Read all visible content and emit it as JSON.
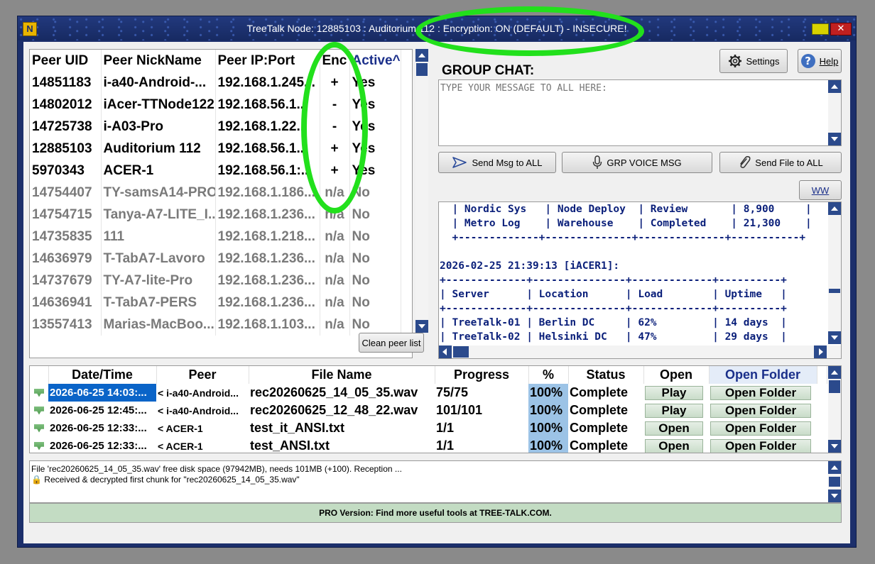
{
  "window": {
    "title": "TreeTalk Node: 12885103 : Auditorium 112 : Encryption: ON (DEFAULT) - INSECURE!",
    "app_icon": "N",
    "close_glyph": "✕"
  },
  "peers": {
    "headers": [
      "Peer UID",
      "Peer NickName",
      "Peer IP:Port",
      "Enc",
      "Active^"
    ],
    "rows": [
      {
        "uid": "14851183",
        "nick": "i-a40-Android-...",
        "ip": "192.168.1.245...",
        "enc": "+",
        "active": "Yes",
        "online": true
      },
      {
        "uid": "14802012",
        "nick": "iAcer-TTNode122",
        "ip": "192.168.56.1...",
        "enc": "-",
        "active": "Yes",
        "online": true
      },
      {
        "uid": "14725738",
        "nick": "i-A03-Pro",
        "ip": "192.168.1.22...",
        "enc": "-",
        "active": "Yes",
        "online": true
      },
      {
        "uid": "12885103",
        "nick": "Auditorium 112",
        "ip": "192.168.56.1...",
        "enc": "+",
        "active": "Yes",
        "online": true
      },
      {
        "uid": "5970343",
        "nick": "ACER-1",
        "ip": "192.168.56.1:...",
        "enc": "+",
        "active": "Yes",
        "online": true
      },
      {
        "uid": "14754407",
        "nick": "TY-samsA14-PRO",
        "ip": "192.168.1.186...",
        "enc": "n/a",
        "active": "No",
        "online": false
      },
      {
        "uid": "14754715",
        "nick": "Tanya-A7-LITE_I...",
        "ip": "192.168.1.236...",
        "enc": "n/a",
        "active": "No",
        "online": false
      },
      {
        "uid": "14735835",
        "nick": "111",
        "ip": "192.168.1.218...",
        "enc": "n/a",
        "active": "No",
        "online": false
      },
      {
        "uid": "14636979",
        "nick": "T-TabA7-Lavoro",
        "ip": "192.168.1.236...",
        "enc": "n/a",
        "active": "No",
        "online": false
      },
      {
        "uid": "14737679",
        "nick": "TY-A7-lite-Pro",
        "ip": "192.168.1.236...",
        "enc": "n/a",
        "active": "No",
        "online": false
      },
      {
        "uid": "14636941",
        "nick": "T-TabA7-PERS",
        "ip": "192.168.1.236...",
        "enc": "n/a",
        "active": "No",
        "online": false
      },
      {
        "uid": "13557413",
        "nick": "Marias-MacBoo...",
        "ip": "192.168.1.103...",
        "enc": "n/a",
        "active": "No",
        "online": false
      }
    ],
    "clean_label": "Clean peer list"
  },
  "chat": {
    "title": "GROUP CHAT:",
    "placeholder": "TYPE YOUR MESSAGE TO ALL HERE:",
    "settings_label": "Settings",
    "help_label": "Help",
    "send_msg_label": "Send Msg to ALL",
    "voice_label": "GRP VOICE MSG",
    "send_file_label": "Send File to ALL",
    "ww_label": "WW",
    "log_lines": [
      "  | Nordic Sys   | Node Deploy  | Review       | 8,900     |",
      "  | Metro Log    | Warehouse    | Completed    | 21,300    |",
      "  +-------------+--------------+--------------+-----------+",
      "",
      "2026-02-25 21:39:13 [iACER1]:",
      "+-------------+---------------+-------------+----------+",
      "| Server      | Location      | Load        | Uptime   |",
      "+-------------+---------------+-------------+----------+",
      "| TreeTalk-01 | Berlin DC     | 62%         | 14 days  |",
      "| TreeTalk-02 | Helsinki DC   | 47%         | 29 days  |"
    ]
  },
  "transfers": {
    "headers": [
      "Date/Time",
      "Peer",
      "File Name",
      "Progress",
      "%",
      "Status",
      "Open",
      "Open Folder"
    ],
    "rows": [
      {
        "date": "2026-06-25 14:03:...",
        "peer": "< i-a40-Android...",
        "file": "rec20260625_14_05_35.wav",
        "progress": "75/75",
        "pct": "100%",
        "status": "Complete",
        "open": "Play",
        "folder": "Open Folder"
      },
      {
        "date": "2026-06-25 12:45:...",
        "peer": "< i-a40-Android...",
        "file": "rec20260625_12_48_22.wav",
        "progress": "101/101",
        "pct": "100%",
        "status": "Complete",
        "open": "Play",
        "folder": "Open Folder"
      },
      {
        "date": "2026-06-25 12:33:...",
        "peer": "< ACER-1",
        "file": "test_it_ANSI.txt",
        "progress": "1/1",
        "pct": "100%",
        "status": "Complete",
        "open": "Open",
        "folder": "Open Folder"
      },
      {
        "date": "2026-06-25 12:33:...",
        "peer": "< ACER-1",
        "file": "test_ANSI.txt",
        "progress": "1/1",
        "pct": "100%",
        "status": "Complete",
        "open": "Open",
        "folder": "Open Folder"
      }
    ]
  },
  "log": {
    "lines": [
      "File 'rec20260625_14_05_35.wav' free disk space (97942MB), needs 101MB (+100). Reception ...",
      "🔒 Received & decrypted first chunk for \"rec20260625_14_05_35.wav\""
    ]
  },
  "footer": {
    "text": "PRO Version: Find more useful tools at TREE-TALK.COM."
  },
  "colors": {
    "title_bar": "#1c2f6b",
    "highlight_green": "#22e01c",
    "percent_cell": "#9cc3e6",
    "footer_bg": "#c3dcc3",
    "chat_text": "#0a1f7a",
    "selected_cell": "#0a64c8"
  },
  "icons": [
    "app-icon",
    "minimize-icon",
    "close-icon",
    "gear-icon",
    "help-icon",
    "send-icon",
    "microphone-icon",
    "paperclip-icon",
    "download-icon",
    "lock-icon"
  ]
}
